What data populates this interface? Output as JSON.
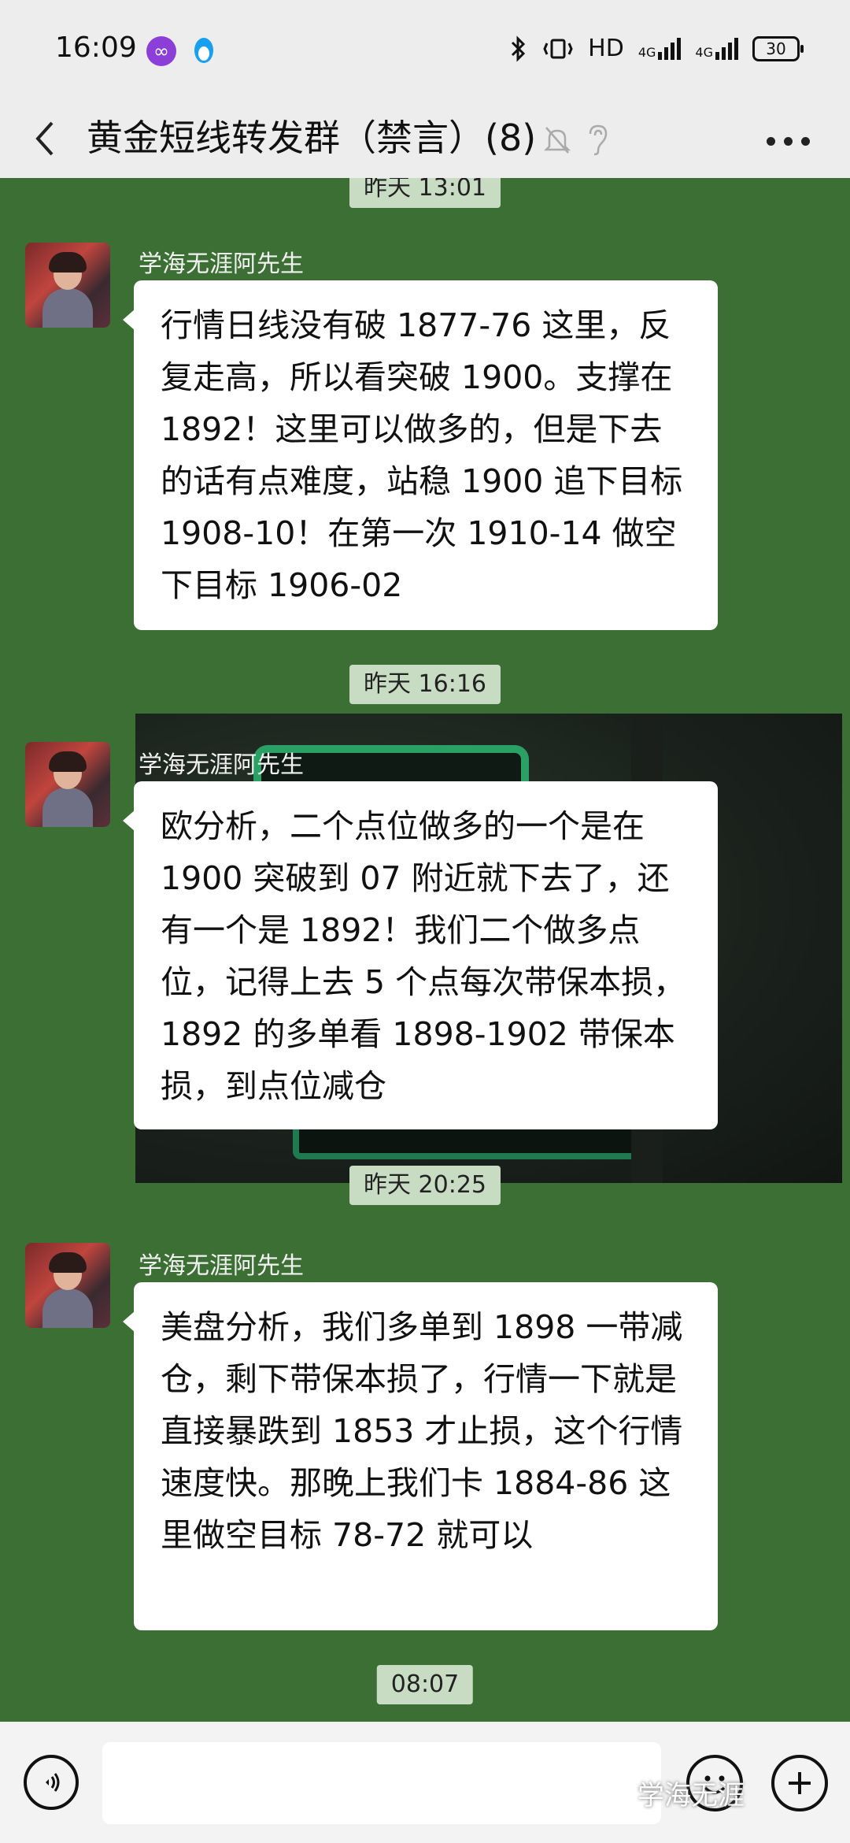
{
  "status_bar": {
    "time": "16:09",
    "network_text": "HD",
    "signal1": "4G",
    "signal2": "4G",
    "battery": "30"
  },
  "header": {
    "title": "黄金短线转发群（禁言）(8)"
  },
  "messages": [
    {
      "timestamp": "昨天 13:01",
      "sender": "学海无涯阿先生",
      "text": "行情日线没有破 1877-76 这里，反复走高，所以看突破 1900。支撑在 1892！这里可以做多的，但是下去的话有点难度，站稳 1900 追下目标 1908-10！在第一次 1910-14 做空下目标 1906-02"
    },
    {
      "timestamp": "昨天 16:16",
      "sender": "学海无涯阿先生",
      "text": "欧分析，二个点位做多的一个是在 1900 突破到 07 附近就下去了，还有一个是 1892！我们二个做多点位，记得上去 5 个点每次带保本损，1892 的多单看 1898-1902 带保本损，到点位减仓"
    },
    {
      "timestamp": "昨天 20:25",
      "sender": "学海无涯阿先生",
      "text": "美盘分析，我们多单到 1898 一带减仓，剩下带保本损了，行情一下就是直接暴跌到 1853 才止损，这个行情速度快。那晚上我们卡 1884-86 这里做空目标 78-72 就可以"
    },
    {
      "timestamp": "08:07"
    }
  ],
  "watermark": "学海无涯",
  "colors": {
    "chat_background": "#3c6f34",
    "bubble": "#ffffff",
    "header": "#ededed"
  }
}
